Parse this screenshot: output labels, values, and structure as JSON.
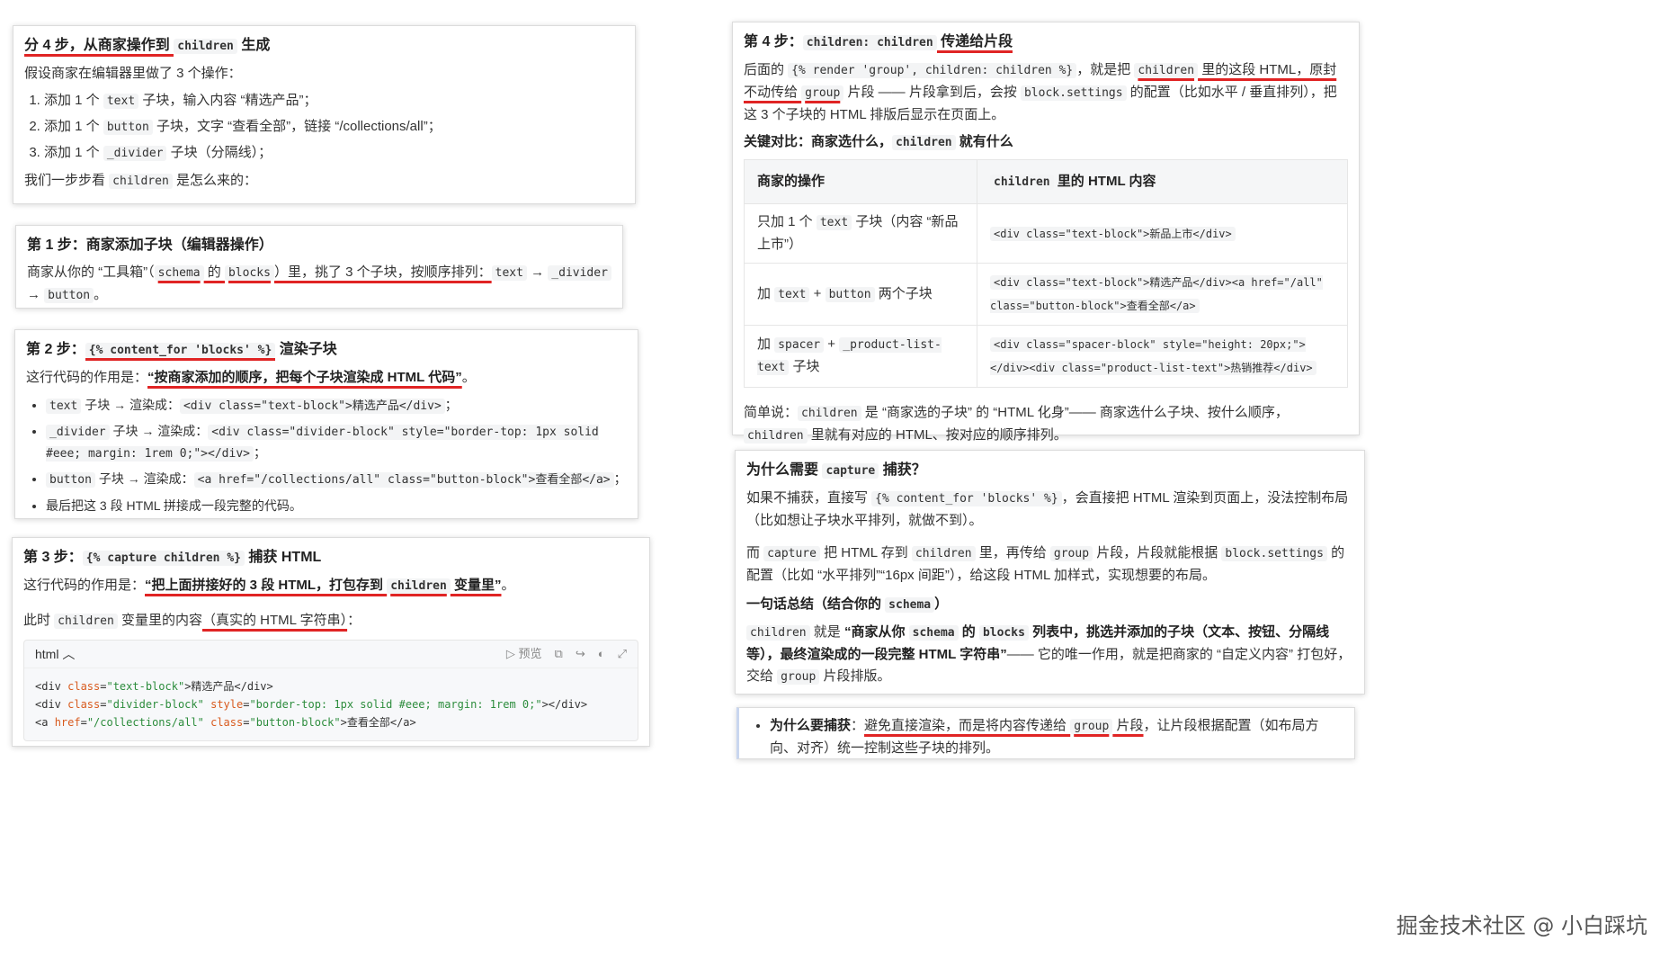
{
  "card1": {
    "title_pre": "分 4 步，从商家操作到 ",
    "title_code": "children",
    "title_post": " 生成",
    "intro": "假设商家在编辑器里做了 3 个操作：",
    "items": [
      {
        "a": "添加 1 个 ",
        "code": "text",
        "b": " 子块，输入内容 “精选产品”；"
      },
      {
        "a": "添加 1 个 ",
        "code": "button",
        "b": " 子块，文字 “查看全部”，链接 “/collections/all”；"
      },
      {
        "a": "添加 1 个 ",
        "code": "_divider",
        "b": " 子块（分隔线）；"
      }
    ],
    "outro_pre": "我们一步步看 ",
    "outro_code": "children",
    "outro_post": " 是怎么来的："
  },
  "card2": {
    "title": "第 1 步：商家添加子块（编辑器操作）",
    "t1": "商家从你的 “工具箱”（",
    "c1": "schema",
    "t2": " 的 ",
    "c2": "blocks",
    "t3": "）里，挑了 3 个子块，按顺序排列：",
    "c3": "text",
    "arrow1": " → ",
    "c4": "_divider",
    "arrow2": " → ",
    "c5": "button",
    "t4": "。"
  },
  "card3": {
    "title_pre": "第 2 步：",
    "title_code": "{% content_for 'blocks' %}",
    "title_post": " 渲染子块",
    "desc_pre": "这行代码的作用是：",
    "desc_bold": "“按商家添加的顺序，把每个子块渲染成 HTML 代码”",
    "desc_post": "。",
    "bullets": [
      {
        "code": "text",
        "mid": " 子块 → 渲染成：",
        "out": "<div class=\"text-block\">精选产品</div>",
        "end": "；"
      },
      {
        "code": "_divider",
        "mid": " 子块 → 渲染成：",
        "out": "<div class=\"divider-block\" style=\"border-top: 1px solid #eee; margin: 1rem 0;\"></div>",
        "end": "；"
      },
      {
        "code": "button",
        "mid": " 子块 → 渲染成：",
        "out": "<a href=\"/collections/all\" class=\"button-block\">查看全部</a>",
        "end": "；"
      }
    ],
    "last": "最后把这 3 段 HTML 拼接成一段完整的代码。"
  },
  "card4": {
    "title_pre": "第 3 步：",
    "title_code": "{% capture children %}",
    "title_post": " 捕获 HTML",
    "desc_pre": "这行代码的作用是：",
    "desc_bold1": "“把上面拼接好的 3 段 HTML，打包存到 ",
    "desc_code": "children",
    "desc_bold2": " 变量里”",
    "desc_post": "。",
    "now_pre": "此时 ",
    "now_code": "children",
    "now_mid": " 变量里的内容",
    "now_red": "（真实的 HTML 字符串）",
    "now_post": "：",
    "codeblock": {
      "lang": "html",
      "preview": "预览",
      "line1_tag": "<div ",
      "line1_attr": "class",
      "line1_val": "\"text-block\"",
      "line1_rest": ">精选产品</div>",
      "line2_tag": "<div ",
      "line2_attr1": "class",
      "line2_val1": "\"divider-block\"",
      "line2_attr2": "style",
      "line2_val2": "\"border-top: 1px solid #eee; margin: 1rem 0;\"",
      "line2_rest": "></div>",
      "line3_tag": "<a ",
      "line3_attr1": "href",
      "line3_val1": "\"/collections/all\"",
      "line3_attr2": "class",
      "line3_val2": "\"button-block\"",
      "line3_rest": ">查看全部</a>"
    }
  },
  "card5": {
    "title_pre": "第 4 步：",
    "title_code": "children: children",
    "title_post": " 传递给片段",
    "p1_a": "后面的 ",
    "p1_c1": "{% render 'group', children: children %}",
    "p1_b": "，就是把 ",
    "p1_c2": "children",
    "p1_c": " 里的这段 HTML，原封不动传给 ",
    "p1_c3": "group",
    "p1_d": " 片段 —— 片段拿到后，会按 ",
    "p1_c4": "block.settings",
    "p1_e": " 的配置（比如水平 / 垂直排列），把这 3 个子块的 HTML 排版后显示在页面上。",
    "key_pre": "关键对比：商家选什么，",
    "key_code": "children",
    "key_post": " 就有什么",
    "table": {
      "head1": "商家的操作",
      "head2_code": "children",
      "head2_post": " 里的 HTML 内容",
      "rows": [
        {
          "op_a": "只加 1 个 ",
          "op_c": "text",
          "op_b": " 子块（内容 “新品上市”）",
          "html": "<div class=\"text-block\">新品上市</div>"
        },
        {
          "op_a": "加 ",
          "op_c": "text",
          "op_b": " + ",
          "op_c2": "button",
          "op_d": " 两个子块",
          "html": "<div class=\"text-block\">精选产品</div><a href=\"/all\" class=\"button-block\">查看全部</a>"
        },
        {
          "op_a": "加 ",
          "op_c": "spacer",
          "op_b": " + ",
          "op_c2": "_product-list-text",
          "op_d": " 子块",
          "html": "<div class=\"spacer-block\" style=\"height: 20px;\"></div><div class=\"product-list-text\">热销推荐</div>"
        }
      ]
    },
    "sum_a": "简单说：",
    "sum_c1": "children",
    "sum_b": " 是 “商家选的子块” 的 “HTML 化身”—— 商家选什么子块、按什么顺序，",
    "sum_c2": "children",
    "sum_c": " 里就有对应的 HTML、按对应的顺序排列。"
  },
  "card6": {
    "title_pre": "为什么需要 ",
    "title_code": "capture",
    "title_post": " 捕获？",
    "p1_a": "如果不捕获，直接写 ",
    "p1_c": "{% content_for 'blocks' %}",
    "p1_b": "，会直接把 HTML 渲染到页面上，没法控制布局（比如想让子块水平排列，就做不到）。",
    "p2_a": "而 ",
    "p2_c1": "capture",
    "p2_b": " 把 HTML 存到 ",
    "p2_c2": "children",
    "p2_c": " 里，再传给 ",
    "p2_c3": "group",
    "p2_d": " 片段，片段就能根据 ",
    "p2_c4": "block.settings",
    "p2_e": " 的配置（比如 “水平排列”“16px 间距”），给这段 HTML 加样式，实现想要的布局。",
    "sum_title_pre": "一句话总结（结合你的 ",
    "sum_title_code": "schema",
    "sum_title_post": "）",
    "sum_c1": "children",
    "sum_a": " 就是 ",
    "sum_bold1": "“商家从你 ",
    "sum_c2": "schema",
    "sum_bold2": " 的 ",
    "sum_c3": "blocks",
    "sum_bold3": " 列表中，挑选并添加的子块（文本、按钮、分隔线等），最终渲染成的一段完整 HTML 字符串”",
    "sum_b": "—— 它的唯一作用，就是把商家的 “自定义内容” 打包好，交给 ",
    "sum_c4": "group",
    "sum_c": " 片段排版。"
  },
  "card7": {
    "label": "为什么要捕获",
    "colon": "：",
    "red": "避免直接渲染，而是将内容传递给 ",
    "code": "group",
    "red2": " 片段",
    "rest": "，让片段根据配置（如布局方向、对齐）统一控制这些子块的排列。"
  },
  "watermark": "掘金技术社区 @ 小白踩坑",
  "colors": {
    "accent_red": "#e02424",
    "code_bg": "#f3f4f5",
    "attr": "#d85a1e",
    "string": "#2c8c3c"
  }
}
